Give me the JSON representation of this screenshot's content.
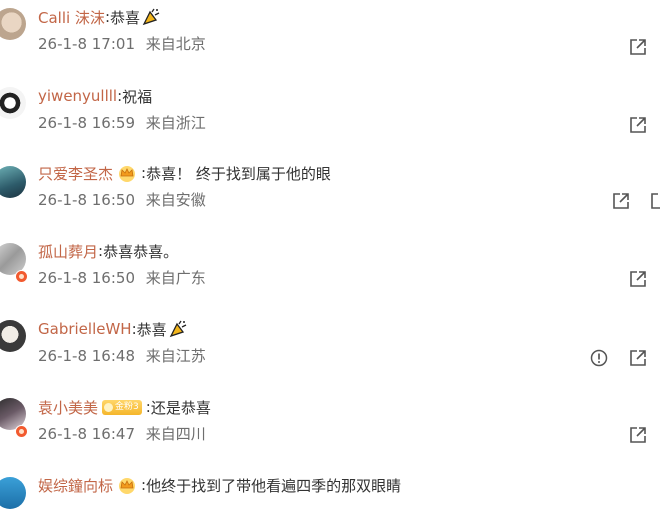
{
  "comments": [
    {
      "username": "Calli 沫沫",
      "colon": ":",
      "text": "恭喜",
      "time": "26-1-8 17:01",
      "location": "来自北京",
      "emoji": "party-popper",
      "crown": false,
      "vip_badge": "",
      "report": false
    },
    {
      "username": "yiwenyullll",
      "colon": ":",
      "text": "祝福",
      "time": "26-1-8 16:59",
      "location": "来自浙江",
      "emoji": "",
      "crown": false,
      "vip_badge": "",
      "report": false
    },
    {
      "username": "只爱李圣杰",
      "colon": ":",
      "text": "恭喜！ 终于找到属于他的眼",
      "time": "26-1-8 16:50",
      "location": "来自安徽",
      "emoji": "",
      "crown": true,
      "vip_badge": "",
      "report": false
    },
    {
      "username": "孤山葬月",
      "colon": ":",
      "text": "恭喜恭喜。",
      "time": "26-1-8 16:50",
      "location": "来自广东",
      "emoji": "",
      "crown": false,
      "vip_badge": "",
      "report": false
    },
    {
      "username": "GabrielleWH",
      "colon": ":",
      "text": "恭喜",
      "time": "26-1-8 16:48",
      "location": "来自江苏",
      "emoji": "party-popper",
      "crown": false,
      "vip_badge": "",
      "report": true
    },
    {
      "username": "袁小美美",
      "colon": ":",
      "text": "还是恭喜",
      "time": "26-1-8 16:47",
      "location": "来自四川",
      "emoji": "",
      "crown": false,
      "vip_badge": "金粉3",
      "report": false
    },
    {
      "username": "娱综鐘向标",
      "colon": ":",
      "text": "他终于找到了带他看遍四季的那双眼睛",
      "time": "",
      "location": "",
      "emoji": "",
      "crown": true,
      "vip_badge": "",
      "report": false
    }
  ],
  "icons": {
    "share": "share-icon",
    "report": "report-icon",
    "party": "party-popper-icon",
    "crown": "crown-icon"
  },
  "colors": {
    "username": "#c26647",
    "meta": "#6e6e6e",
    "text": "#333333",
    "icon": "#666666"
  }
}
